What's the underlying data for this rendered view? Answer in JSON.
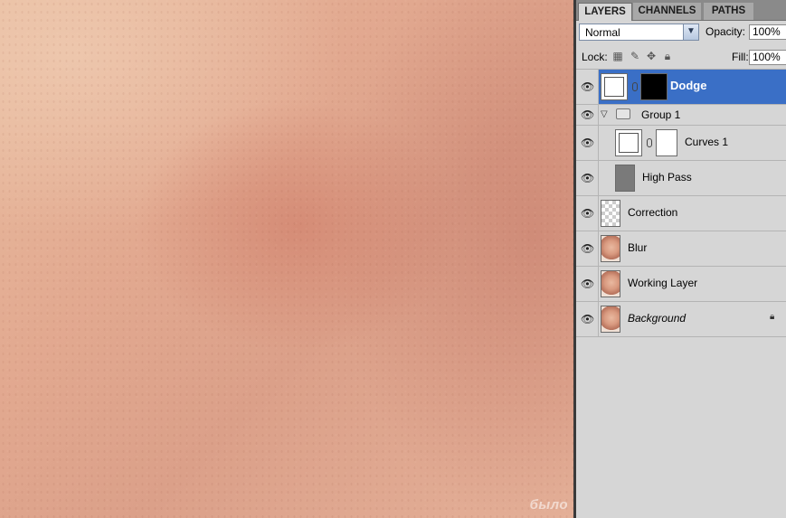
{
  "canvas": {
    "watermark": "было"
  },
  "panel": {
    "tabs": [
      "LAYERS",
      "CHANNELS",
      "PATHS"
    ],
    "blend_mode": "Normal",
    "opacity_label": "Opacity:",
    "opacity_value": "100%",
    "lock_label": "Lock:",
    "fill_label": "Fill:",
    "fill_value": "100%",
    "layers": [
      {
        "name": "Dodge",
        "selected": true,
        "type": "adjustment",
        "mask": "black"
      },
      {
        "name": "Group 1",
        "type": "group",
        "expanded": true
      },
      {
        "name": "Curves 1",
        "type": "adjustment",
        "mask": "white",
        "in_group": true
      },
      {
        "name": "High Pass",
        "type": "gray",
        "in_group": true
      },
      {
        "name": "Correction",
        "type": "transparent"
      },
      {
        "name": "Blur",
        "type": "photo"
      },
      {
        "name": "Working Layer",
        "type": "photo"
      },
      {
        "name": "Background",
        "type": "photo",
        "italic": true,
        "locked": true
      }
    ]
  },
  "icons": {
    "eye": "eye-icon",
    "lock": "lock-icon",
    "chain": "link-icon",
    "folder": "folder-icon"
  }
}
